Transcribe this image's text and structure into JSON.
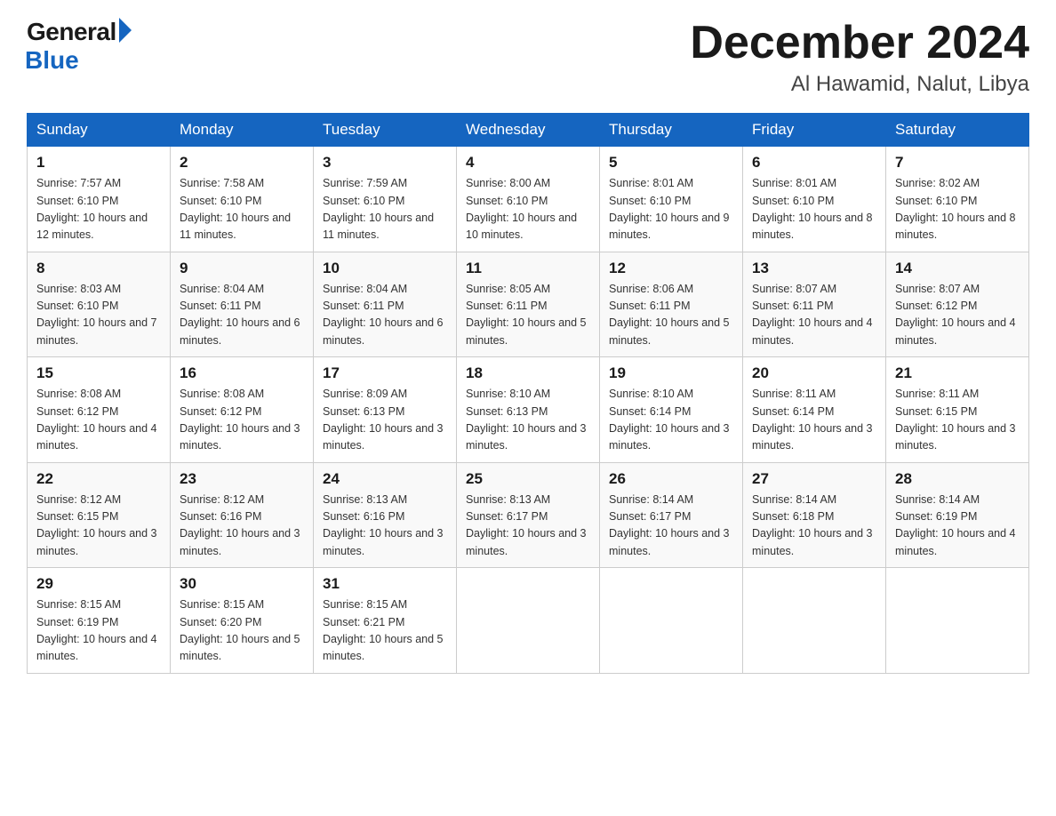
{
  "header": {
    "logo_general": "General",
    "logo_blue": "Blue",
    "month": "December 2024",
    "location": "Al Hawamid, Nalut, Libya"
  },
  "days_of_week": [
    "Sunday",
    "Monday",
    "Tuesday",
    "Wednesday",
    "Thursday",
    "Friday",
    "Saturday"
  ],
  "weeks": [
    [
      {
        "day": "1",
        "sunrise": "7:57 AM",
        "sunset": "6:10 PM",
        "daylight": "10 hours and 12 minutes."
      },
      {
        "day": "2",
        "sunrise": "7:58 AM",
        "sunset": "6:10 PM",
        "daylight": "10 hours and 11 minutes."
      },
      {
        "day": "3",
        "sunrise": "7:59 AM",
        "sunset": "6:10 PM",
        "daylight": "10 hours and 11 minutes."
      },
      {
        "day": "4",
        "sunrise": "8:00 AM",
        "sunset": "6:10 PM",
        "daylight": "10 hours and 10 minutes."
      },
      {
        "day": "5",
        "sunrise": "8:01 AM",
        "sunset": "6:10 PM",
        "daylight": "10 hours and 9 minutes."
      },
      {
        "day": "6",
        "sunrise": "8:01 AM",
        "sunset": "6:10 PM",
        "daylight": "10 hours and 8 minutes."
      },
      {
        "day": "7",
        "sunrise": "8:02 AM",
        "sunset": "6:10 PM",
        "daylight": "10 hours and 8 minutes."
      }
    ],
    [
      {
        "day": "8",
        "sunrise": "8:03 AM",
        "sunset": "6:10 PM",
        "daylight": "10 hours and 7 minutes."
      },
      {
        "day": "9",
        "sunrise": "8:04 AM",
        "sunset": "6:11 PM",
        "daylight": "10 hours and 6 minutes."
      },
      {
        "day": "10",
        "sunrise": "8:04 AM",
        "sunset": "6:11 PM",
        "daylight": "10 hours and 6 minutes."
      },
      {
        "day": "11",
        "sunrise": "8:05 AM",
        "sunset": "6:11 PM",
        "daylight": "10 hours and 5 minutes."
      },
      {
        "day": "12",
        "sunrise": "8:06 AM",
        "sunset": "6:11 PM",
        "daylight": "10 hours and 5 minutes."
      },
      {
        "day": "13",
        "sunrise": "8:07 AM",
        "sunset": "6:11 PM",
        "daylight": "10 hours and 4 minutes."
      },
      {
        "day": "14",
        "sunrise": "8:07 AM",
        "sunset": "6:12 PM",
        "daylight": "10 hours and 4 minutes."
      }
    ],
    [
      {
        "day": "15",
        "sunrise": "8:08 AM",
        "sunset": "6:12 PM",
        "daylight": "10 hours and 4 minutes."
      },
      {
        "day": "16",
        "sunrise": "8:08 AM",
        "sunset": "6:12 PM",
        "daylight": "10 hours and 3 minutes."
      },
      {
        "day": "17",
        "sunrise": "8:09 AM",
        "sunset": "6:13 PM",
        "daylight": "10 hours and 3 minutes."
      },
      {
        "day": "18",
        "sunrise": "8:10 AM",
        "sunset": "6:13 PM",
        "daylight": "10 hours and 3 minutes."
      },
      {
        "day": "19",
        "sunrise": "8:10 AM",
        "sunset": "6:14 PM",
        "daylight": "10 hours and 3 minutes."
      },
      {
        "day": "20",
        "sunrise": "8:11 AM",
        "sunset": "6:14 PM",
        "daylight": "10 hours and 3 minutes."
      },
      {
        "day": "21",
        "sunrise": "8:11 AM",
        "sunset": "6:15 PM",
        "daylight": "10 hours and 3 minutes."
      }
    ],
    [
      {
        "day": "22",
        "sunrise": "8:12 AM",
        "sunset": "6:15 PM",
        "daylight": "10 hours and 3 minutes."
      },
      {
        "day": "23",
        "sunrise": "8:12 AM",
        "sunset": "6:16 PM",
        "daylight": "10 hours and 3 minutes."
      },
      {
        "day": "24",
        "sunrise": "8:13 AM",
        "sunset": "6:16 PM",
        "daylight": "10 hours and 3 minutes."
      },
      {
        "day": "25",
        "sunrise": "8:13 AM",
        "sunset": "6:17 PM",
        "daylight": "10 hours and 3 minutes."
      },
      {
        "day": "26",
        "sunrise": "8:14 AM",
        "sunset": "6:17 PM",
        "daylight": "10 hours and 3 minutes."
      },
      {
        "day": "27",
        "sunrise": "8:14 AM",
        "sunset": "6:18 PM",
        "daylight": "10 hours and 3 minutes."
      },
      {
        "day": "28",
        "sunrise": "8:14 AM",
        "sunset": "6:19 PM",
        "daylight": "10 hours and 4 minutes."
      }
    ],
    [
      {
        "day": "29",
        "sunrise": "8:15 AM",
        "sunset": "6:19 PM",
        "daylight": "10 hours and 4 minutes."
      },
      {
        "day": "30",
        "sunrise": "8:15 AM",
        "sunset": "6:20 PM",
        "daylight": "10 hours and 5 minutes."
      },
      {
        "day": "31",
        "sunrise": "8:15 AM",
        "sunset": "6:21 PM",
        "daylight": "10 hours and 5 minutes."
      },
      null,
      null,
      null,
      null
    ]
  ],
  "labels": {
    "sunrise_prefix": "Sunrise: ",
    "sunset_prefix": "Sunset: ",
    "daylight_prefix": "Daylight: "
  }
}
